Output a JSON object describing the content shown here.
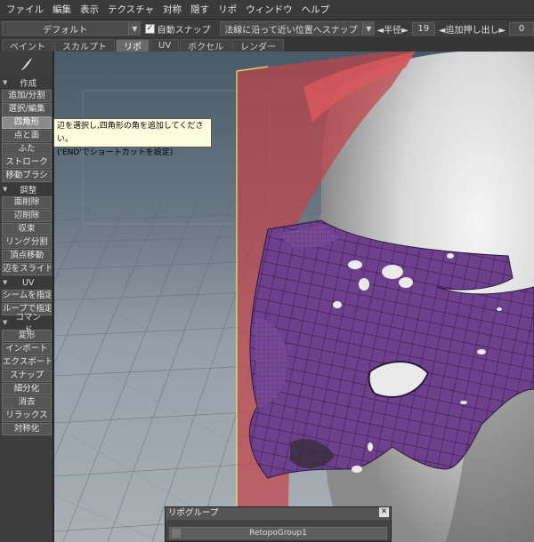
{
  "menubar": {
    "items": [
      "ファイル",
      "編集",
      "表示",
      "テクスチャ",
      "対称",
      "隠す",
      "リポ",
      "ウィンドウ",
      "ヘルプ"
    ]
  },
  "toolbar": {
    "preset": "デフォルト",
    "auto_snap_checked": true,
    "auto_snap_label": "自動スナップ",
    "snap_mode": "法線に沿って近い位置へスナップ",
    "radius_label": "◄半径►",
    "radius_value": "19",
    "extrude_label": "◄追加押し出し►",
    "extrude_value": "0"
  },
  "tabs": [
    {
      "label": "ペイント",
      "active": false
    },
    {
      "label": "スカルプト",
      "active": false
    },
    {
      "label": "リポ",
      "active": true
    },
    {
      "label": "UV",
      "active": false
    },
    {
      "label": "ボクセル",
      "active": false
    },
    {
      "label": "レンダー",
      "active": false
    }
  ],
  "sidebar": {
    "sections": [
      {
        "title": "作成",
        "buttons": [
          {
            "label": "追加/分割",
            "selected": false
          },
          {
            "label": "選択/編集",
            "selected": false
          },
          {
            "label": "四角形",
            "selected": true
          },
          {
            "label": "点と面",
            "selected": false
          },
          {
            "label": "ふた",
            "selected": false
          },
          {
            "label": "ストローク",
            "selected": false
          },
          {
            "label": "移動ブラシ",
            "selected": false
          }
        ]
      },
      {
        "title": "調整",
        "buttons": [
          {
            "label": "面削除",
            "selected": false
          },
          {
            "label": "辺削除",
            "selected": false
          },
          {
            "label": "収束",
            "selected": false
          },
          {
            "label": "リング分割",
            "selected": false
          },
          {
            "label": "頂点移動",
            "selected": false
          },
          {
            "label": "辺をスライド",
            "selected": false
          }
        ]
      },
      {
        "title": "UV",
        "buttons": [
          {
            "label": "シームを指定",
            "selected": false
          },
          {
            "label": "ループで指定",
            "selected": false
          }
        ]
      },
      {
        "title": "コマンド",
        "buttons": [
          {
            "label": "変形",
            "selected": false
          },
          {
            "label": "インポート",
            "selected": false
          },
          {
            "label": "エクスポート",
            "selected": false
          },
          {
            "label": "スナップ",
            "selected": false
          },
          {
            "label": "細分化",
            "selected": false
          },
          {
            "label": "消去",
            "selected": false
          },
          {
            "label": "リラックス",
            "selected": false
          },
          {
            "label": "対称化",
            "selected": false
          }
        ]
      }
    ]
  },
  "tooltip": {
    "line1": "辺を選択し,四角形の角を追加してください。",
    "line2": "('END'でショートカットを設定)"
  },
  "panel": {
    "title": "リポグループ",
    "row": "RetopoGroup1"
  },
  "colors": {
    "viewport_bg_top": "#4a5a68",
    "viewport_bg_bottom": "#a9b0b6",
    "mesh_purple": "#6e3f8c",
    "plane_red": "#c0444a",
    "tooltip_bg": "#fffde0"
  }
}
